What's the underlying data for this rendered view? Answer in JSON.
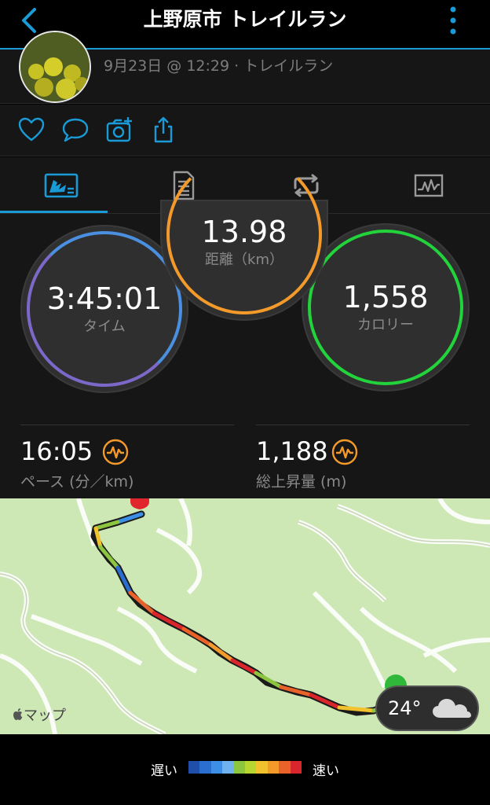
{
  "header": {
    "title": "上野原市 トレイルラン",
    "back_icon": "chevron-left-icon",
    "menu_icon": "more-vertical-icon"
  },
  "activity": {
    "subtitle": "9月23日 @ 12:29 · トレイルラン"
  },
  "social": {
    "icons": [
      "heart-icon",
      "comment-icon",
      "add-photo-icon",
      "share-icon"
    ]
  },
  "tabs": [
    {
      "name": "summary",
      "icon": "map-stats-icon",
      "active": true
    },
    {
      "name": "details",
      "icon": "document-icon",
      "active": false
    },
    {
      "name": "laps",
      "icon": "repeat-icon",
      "active": false
    },
    {
      "name": "charts",
      "icon": "chart-icon",
      "active": false
    }
  ],
  "stats": {
    "time": {
      "value": "3:45:01",
      "label": "タイム"
    },
    "distance": {
      "value": "13.98",
      "label": "距離（km）"
    },
    "calories": {
      "value": "1,558",
      "label": "カロリー"
    },
    "pace": {
      "value": "16:05",
      "label": "ペース (分／km)"
    },
    "elevation": {
      "value": "1,188",
      "label": "総上昇量 (m)"
    }
  },
  "map": {
    "attribution": "マップ",
    "weather": {
      "temp": "24°",
      "icon": "cloud-icon"
    }
  },
  "legend": {
    "slow": "遅い",
    "fast": "速い",
    "colors": [
      "#1f4fa8",
      "#2a6fd0",
      "#3d8fe6",
      "#6fb2ef",
      "#8cc63f",
      "#b8d630",
      "#f2c12e",
      "#f39a2b",
      "#e8622a",
      "#d8262c"
    ]
  },
  "colors": {
    "accent": "#1a9bd7",
    "distance_ring": "#f39a2b",
    "calorie_ring": "#22d33c",
    "time_ring": "#4a8fe0"
  }
}
